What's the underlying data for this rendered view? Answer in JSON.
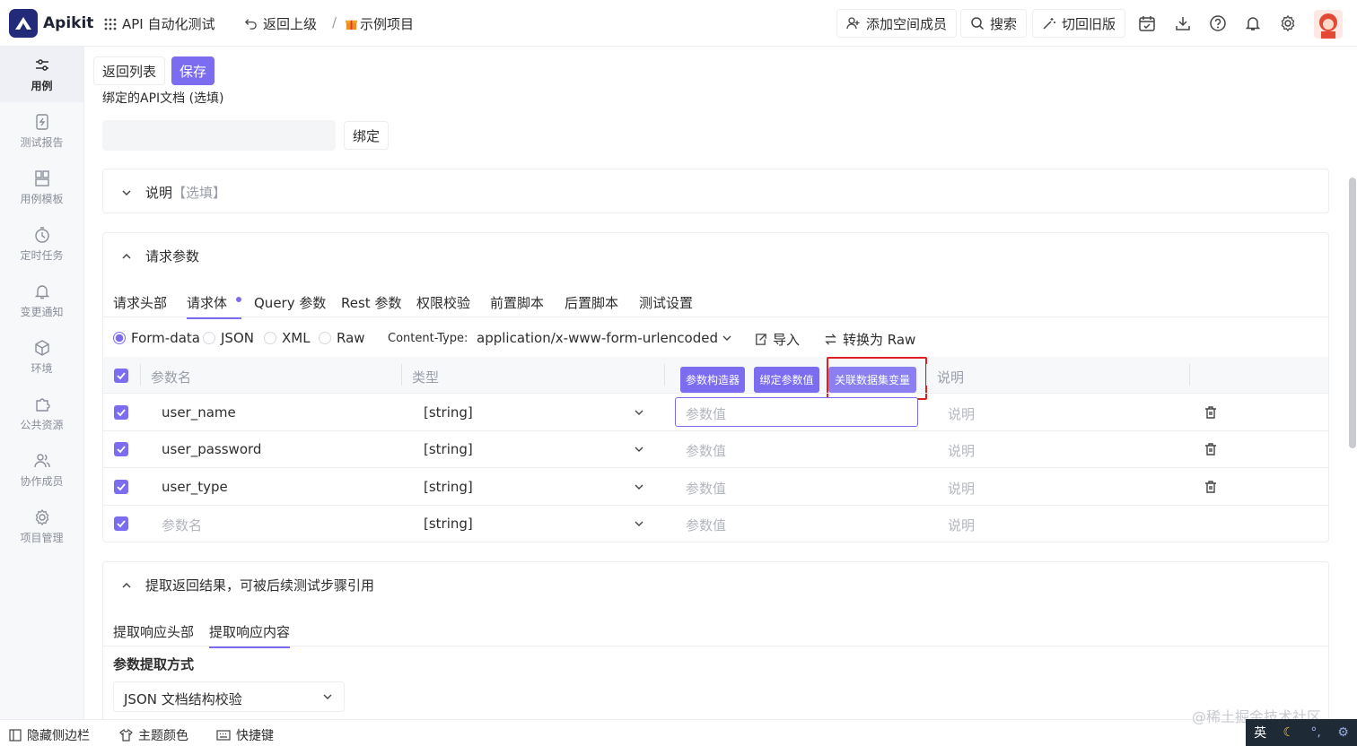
{
  "header": {
    "brand": "Apikit",
    "module": "API 自动化测试",
    "back": "返回上级",
    "separator": "/",
    "project": "示例项目",
    "add_member": "添加空间成员",
    "search": "搜索",
    "old_version": "切回旧版"
  },
  "sidebar": {
    "items": [
      {
        "label": "用例",
        "icon": "sliders-icon"
      },
      {
        "label": "测试报告",
        "icon": "report-icon"
      },
      {
        "label": "用例模板",
        "icon": "template-icon"
      },
      {
        "label": "定时任务",
        "icon": "timer-icon"
      },
      {
        "label": "变更通知",
        "icon": "bell-icon"
      },
      {
        "label": "环境",
        "icon": "cube-icon"
      },
      {
        "label": "公共资源",
        "icon": "puzzle-icon"
      },
      {
        "label": "协作成员",
        "icon": "users-icon"
      },
      {
        "label": "项目管理",
        "icon": "gear-icon"
      }
    ]
  },
  "toolbar": {
    "back_list": "返回列表",
    "save": "保存"
  },
  "bind_doc": {
    "label": "绑定的API文档 (选填)",
    "bind_button": "绑定"
  },
  "description": {
    "title": "说明",
    "optional": "【选填】"
  },
  "request": {
    "title": "请求参数",
    "tabs": [
      "请求头部",
      "请求体",
      "Query 参数",
      "Rest 参数",
      "权限校验",
      "前置脚本",
      "后置脚本",
      "测试设置"
    ],
    "formats": [
      "Form-data",
      "JSON",
      "XML",
      "Raw"
    ],
    "content_type_label": "Content-Type:",
    "content_type_value": "application/x-www-form-urlencoded",
    "import": "导入",
    "convert": "转换为 Raw",
    "columns": {
      "name": "参数名",
      "type": "类型",
      "desc": "说明"
    },
    "mini_buttons": [
      "参数构造器",
      "绑定参数值",
      "关联数据集变量"
    ],
    "rows": [
      {
        "name": "user_name",
        "type": "[string]",
        "value_placeholder": "参数值",
        "desc_placeholder": "说明"
      },
      {
        "name": "user_password",
        "type": "[string]",
        "value_placeholder": "参数值",
        "desc_placeholder": "说明"
      },
      {
        "name": "user_type",
        "type": "[string]",
        "value_placeholder": "参数值",
        "desc_placeholder": "说明"
      },
      {
        "name": "参数名",
        "type": "[string]",
        "value_placeholder": "参数值",
        "desc_placeholder": "说明"
      }
    ]
  },
  "extract": {
    "title": "提取返回结果，可被后续测试步骤引用",
    "tabs": [
      "提取响应头部",
      "提取响应内容"
    ],
    "method_label": "参数提取方式",
    "method_value": "JSON 文档结构校验"
  },
  "bottom": {
    "hide_sidebar": "隐藏侧边栏",
    "theme": "主题颜色",
    "shortcuts": "快捷键",
    "watermark": "@稀土掘金技术社区",
    "ime_lang": "英"
  },
  "colors": {
    "accent": "#7c6cf0",
    "highlight": "#e02020"
  }
}
